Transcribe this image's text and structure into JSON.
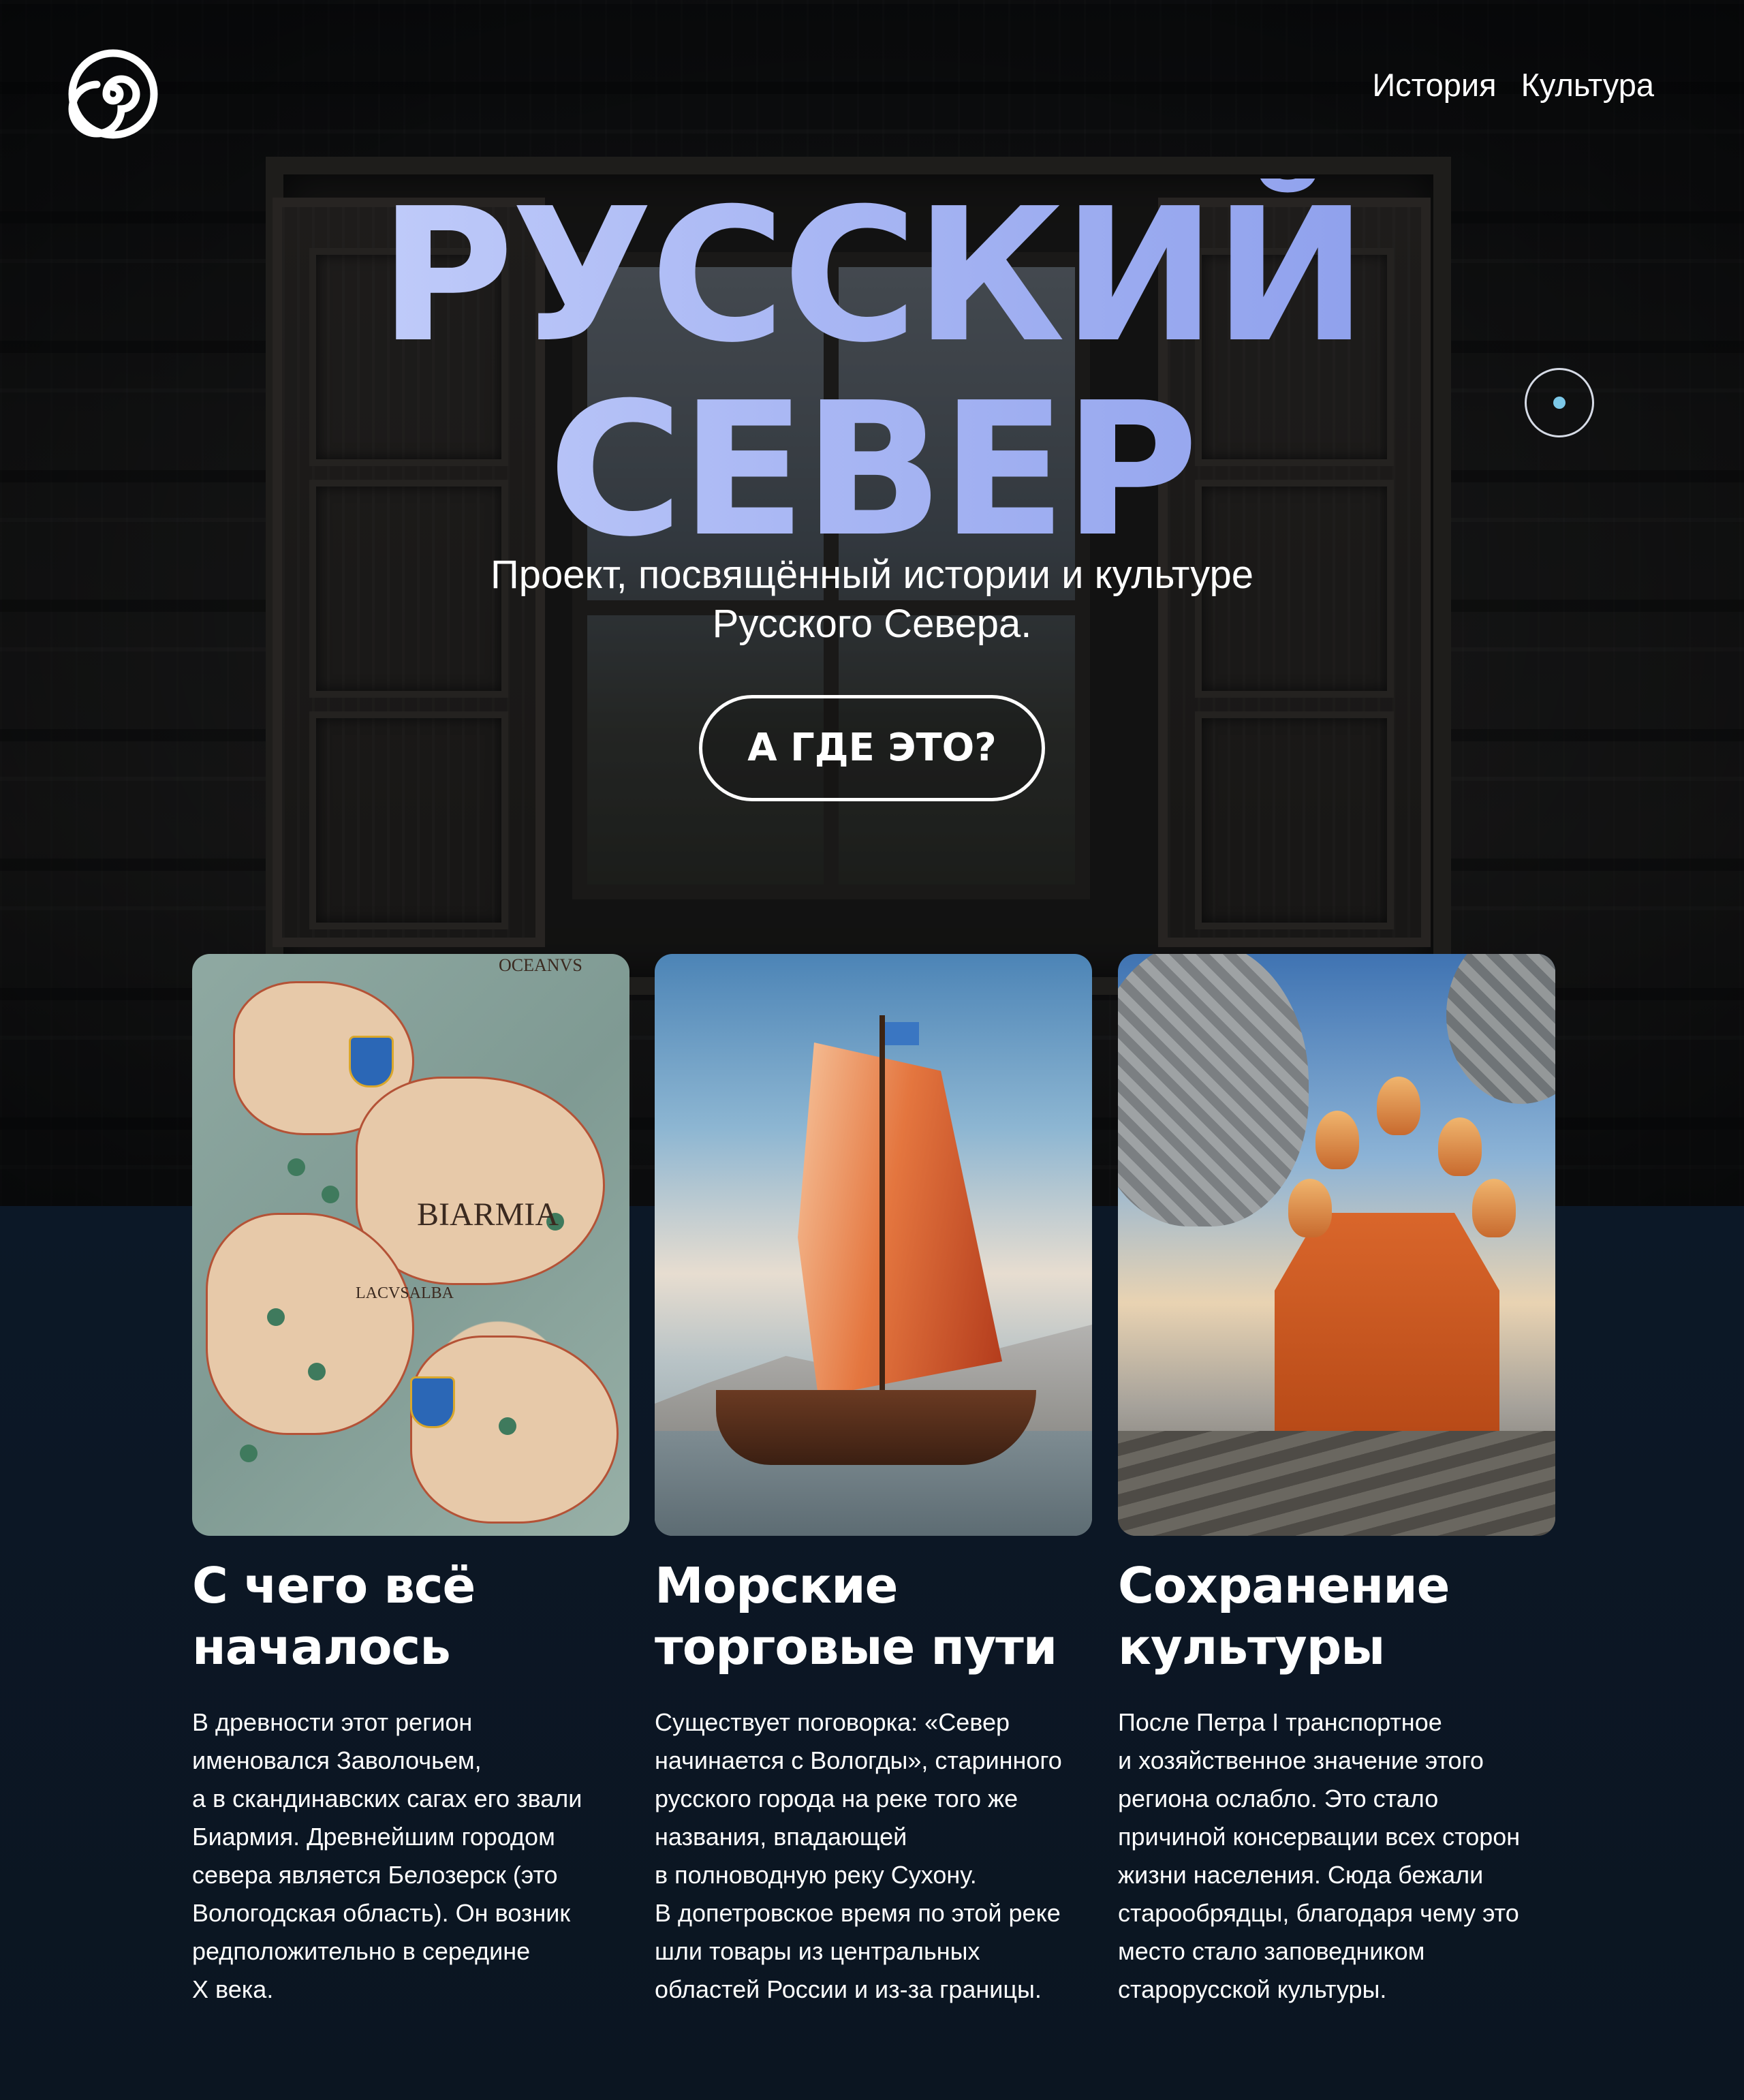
{
  "header": {
    "logo_icon": "spiral-logo-icon",
    "nav": [
      {
        "label": "История"
      },
      {
        "label": "Культура"
      }
    ]
  },
  "hero": {
    "title_line1": "РУССКИЙ",
    "title_line2": "СЕВЕР",
    "subtitle": "Проект, посвящённый истории и культуре\nРусского Севера.",
    "cta_label": "А ГДЕ ЭТО?"
  },
  "cards": [
    {
      "image": "old-map-biarmia",
      "map_labels": [
        "OCEANVS",
        "BIARMIA",
        "LACVSALBA"
      ],
      "title": "С чего всё\nначалось",
      "text": "В древности этот регион\nименовался Заволочьем,\nа в скандинавских сагах его звали\nБиармия. Древнейшим городом\nсевера является Белозерск (это\nВологодская область). Он возник\nредположительно в середине\nX века."
    },
    {
      "image": "viking-ship",
      "title": "Морские\nторговые пути",
      "text": "Существует поговорка: «Север\nначинается с Вологды», старинного\nрусского города на реке того же\nназвания, впадающей\nв полноводную реку Сухону.\nВ допетровское время по этой реке\nшли товары из центральных\nобластей России и из-за границы."
    },
    {
      "image": "wooden-church-kizhi",
      "title": "Сохранение\nкультуры",
      "text": "После Петра I транспортное\nи хозяйственное значение этого\nрегиона ослабло. Это стало\nпричиной консервации всех сторон\nжизни населения. Сюда  бежали\nстарообрядцы, благодаря чему это\nместо стало заповедником\nстарорусской культуры."
    }
  ],
  "colors": {
    "title_gradient_start": "#d3dcff",
    "title_gradient_end": "#7e92e8",
    "background_lower": "#0b1521",
    "scroll_dot_accent": "#7cc8e8"
  }
}
